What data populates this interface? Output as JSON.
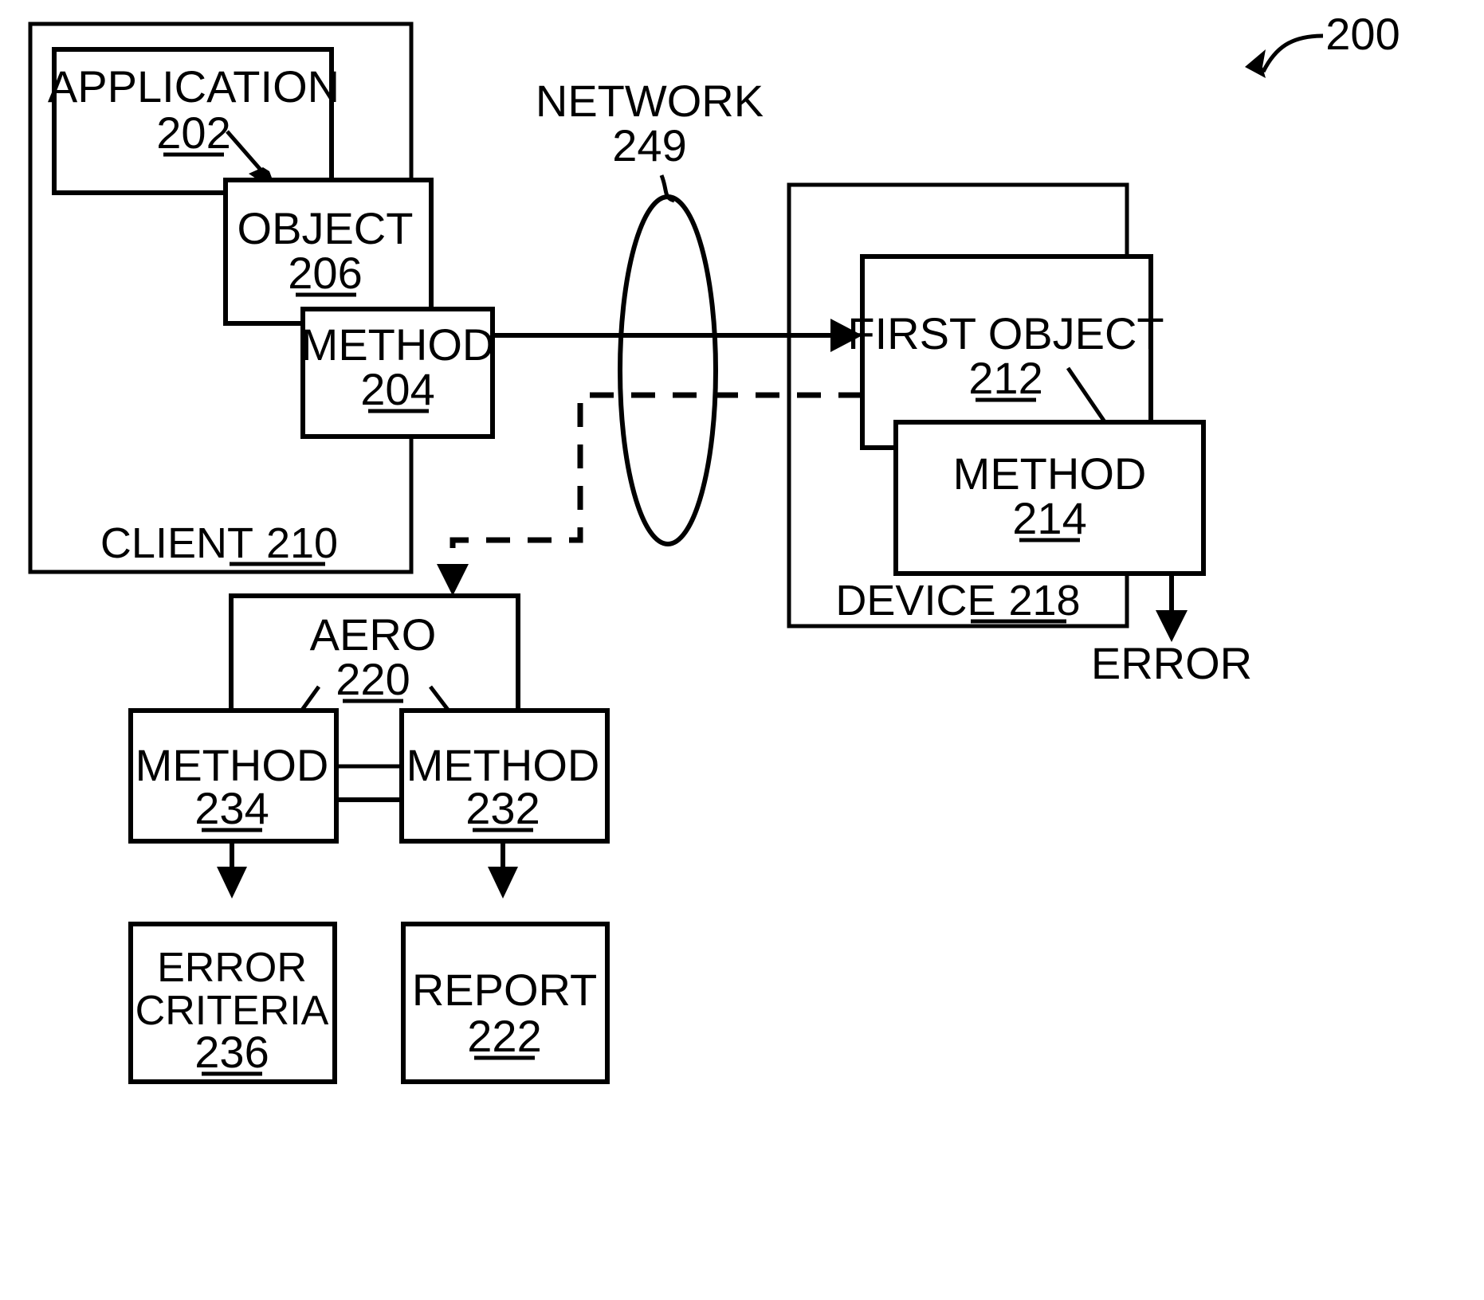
{
  "figure": {
    "figure_number": "200",
    "type": "patent-block-diagram"
  },
  "labels": {
    "client_container": "CLIENT 210",
    "client_name": "CLIENT",
    "client_num": "210",
    "application_name": "APPLICATION",
    "application_num": "202",
    "object_name": "OBJECT",
    "object_num": "206",
    "method204_name": "METHOD",
    "method204_num": "204",
    "network_name": "NETWORK",
    "network_num": "249",
    "device_name": "DEVICE",
    "device_num": "218",
    "first_object_name": "FIRST OBJECT",
    "first_object_num": "212",
    "method214_name": "METHOD",
    "method214_num": "214",
    "error_out": "ERROR",
    "aero_name": "AERO",
    "aero_num": "220",
    "method234_name": "METHOD",
    "method234_num": "234",
    "method232_name": "METHOD",
    "method232_num": "232",
    "error_criteria_line1": "ERROR",
    "error_criteria_line2": "CRITERIA",
    "error_criteria_num": "236",
    "report_name": "REPORT",
    "report_num": "222"
  },
  "colors": {
    "stroke": "#000000",
    "background": "#ffffff"
  },
  "nodes": [
    {
      "id": "client",
      "label": "CLIENT",
      "ref": "210"
    },
    {
      "id": "application",
      "label": "APPLICATION",
      "ref": "202"
    },
    {
      "id": "object",
      "label": "OBJECT",
      "ref": "206"
    },
    {
      "id": "method204",
      "label": "METHOD",
      "ref": "204"
    },
    {
      "id": "network",
      "label": "NETWORK",
      "ref": "249"
    },
    {
      "id": "device",
      "label": "DEVICE",
      "ref": "218"
    },
    {
      "id": "firstobject",
      "label": "FIRST OBJECT",
      "ref": "212"
    },
    {
      "id": "method214",
      "label": "METHOD",
      "ref": "214"
    },
    {
      "id": "error",
      "label": "ERROR",
      "ref": ""
    },
    {
      "id": "aero",
      "label": "AERO",
      "ref": "220"
    },
    {
      "id": "method234",
      "label": "METHOD",
      "ref": "234"
    },
    {
      "id": "method232",
      "label": "METHOD",
      "ref": "232"
    },
    {
      "id": "errorcriteria",
      "label": "ERROR CRITERIA",
      "ref": "236"
    },
    {
      "id": "report",
      "label": "REPORT",
      "ref": "222"
    }
  ],
  "edges": [
    {
      "from": "method204",
      "to": "firstobject",
      "style": "solid-arrow"
    },
    {
      "from": "firstobject",
      "to": "aero",
      "style": "dashed-arrow"
    },
    {
      "from": "method214",
      "to": "error",
      "style": "solid-arrow"
    },
    {
      "from": "method234",
      "to": "errorcriteria",
      "style": "solid-arrow"
    },
    {
      "from": "method232",
      "to": "report",
      "style": "solid-arrow"
    },
    {
      "from": "method234",
      "to": "method232",
      "style": "plain-line"
    }
  ]
}
